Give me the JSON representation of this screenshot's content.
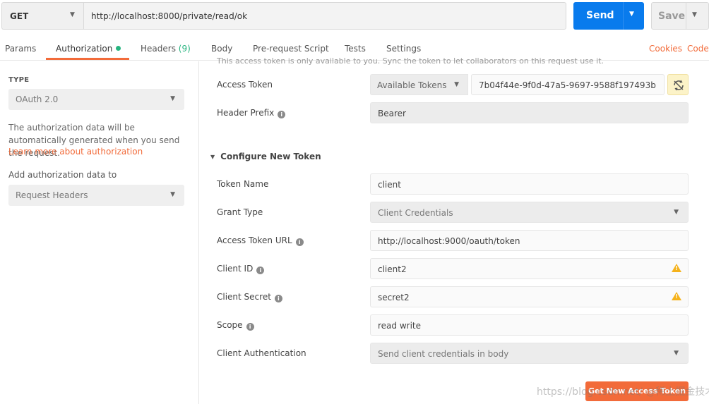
{
  "request": {
    "method": "GET",
    "url": "http://localhost:8000/private/read/ok",
    "send_label": "Send",
    "save_label": "Save"
  },
  "tabs": [
    {
      "label": "Params"
    },
    {
      "label": "Authorization"
    },
    {
      "label": "Headers",
      "count": "(9)"
    },
    {
      "label": "Body"
    },
    {
      "label": "Pre-request Script"
    },
    {
      "label": "Tests"
    },
    {
      "label": "Settings"
    }
  ],
  "tab_links": {
    "cookies": "Cookies",
    "code": "Code"
  },
  "left": {
    "type_label": "TYPE",
    "type_value": "OAuth 2.0",
    "description": "The authorization data will be automatically generated when you send the request.",
    "learn_more": "Learn more about authorization",
    "add_label": "Add authorization data to",
    "add_value": "Request Headers"
  },
  "right": {
    "notice": "This access token is only available to you. Sync the token to let collaborators on this request use it.",
    "access_token_label": "Access Token",
    "available_tokens": "Available Tokens",
    "token_value": "7b04f44e-9f0d-47a5-9697-9588f197493b",
    "header_prefix_label": "Header Prefix",
    "header_prefix_value": "Bearer",
    "configure_title": "Configure New Token",
    "token_name_label": "Token Name",
    "token_name_value": "client",
    "grant_type_label": "Grant Type",
    "grant_type_value": "Client Credentials",
    "access_token_url_label": "Access Token URL",
    "access_token_url_value": "http://localhost:9000/oauth/token",
    "client_id_label": "Client ID",
    "client_id_value": "client2",
    "client_secret_label": "Client Secret",
    "client_secret_value": "secret2",
    "scope_label": "Scope",
    "scope_value": "read write",
    "client_auth_label": "Client Authentication",
    "client_auth_value": "Send client credentials in body",
    "get_token_label": "Get New Access Token"
  },
  "watermark": "https://blog.csdn.net/ @稀土掘金技术社区",
  "colors": {
    "accent": "#f26b3a",
    "send": "#097bed",
    "active_dot": "#26b47f",
    "warning": "#f5b21b"
  }
}
